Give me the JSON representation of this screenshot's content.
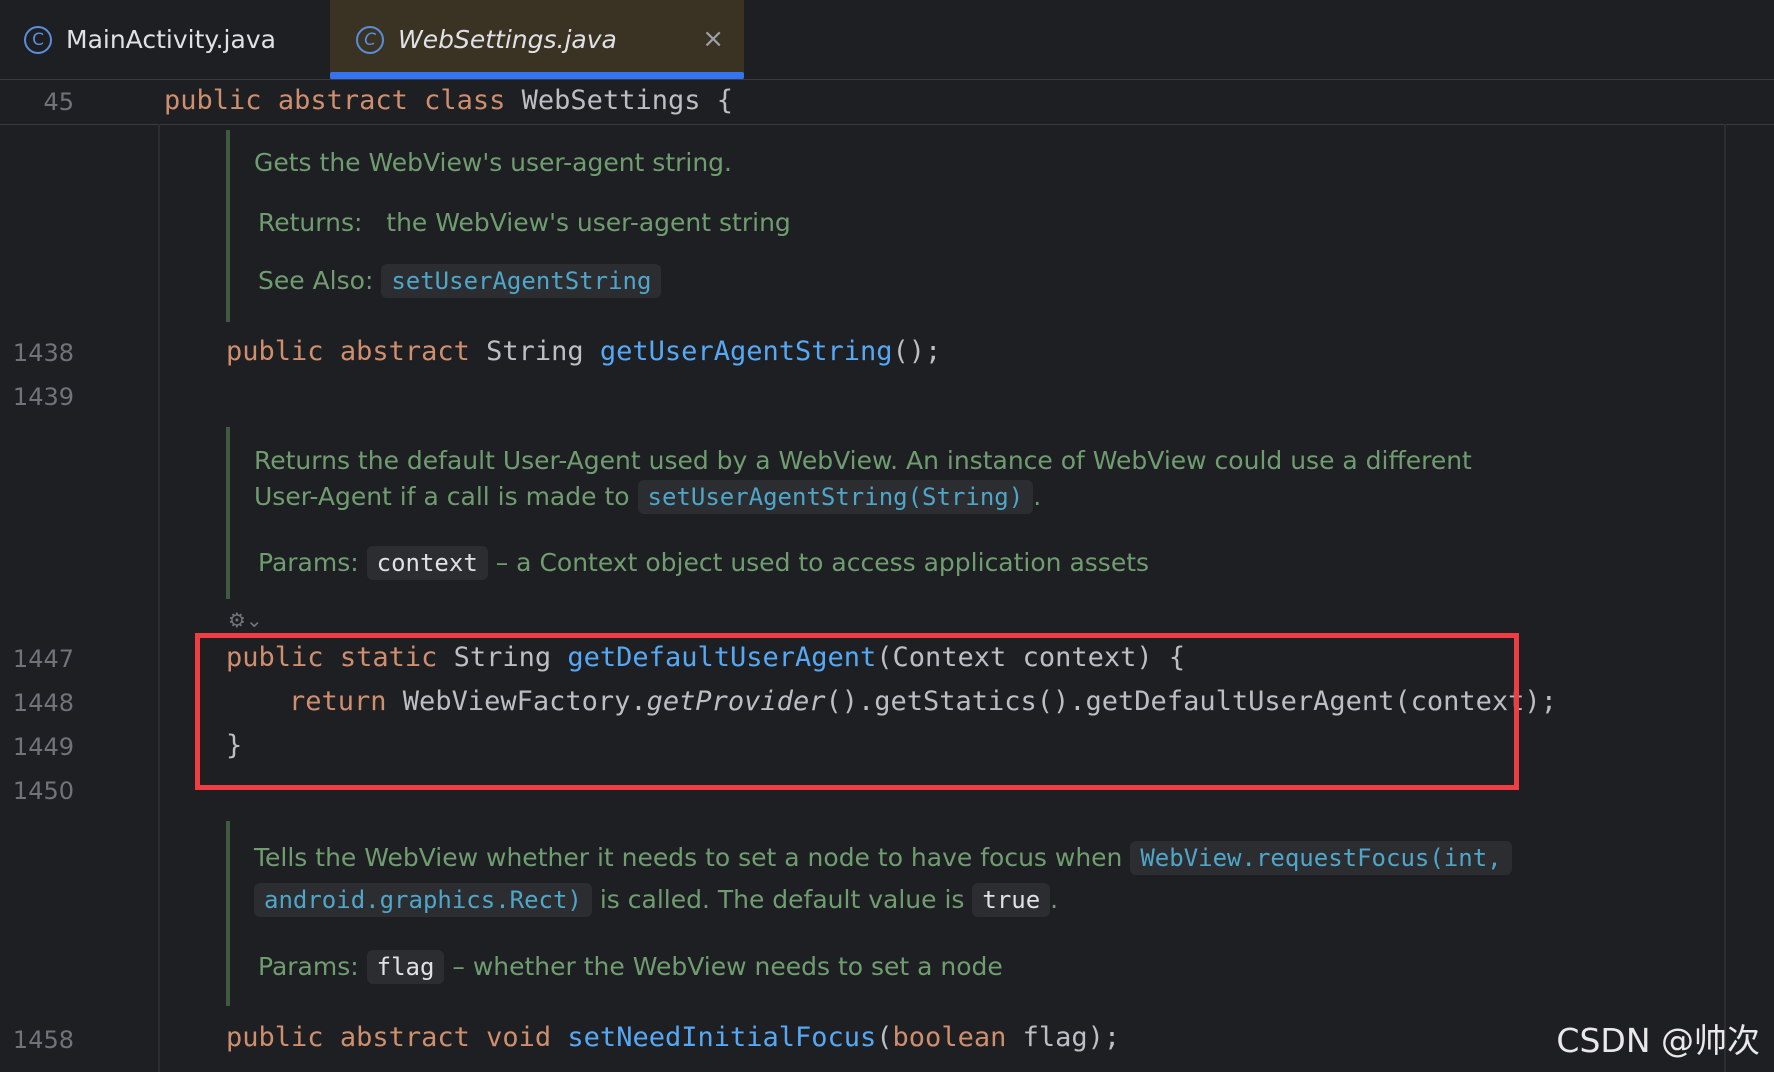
{
  "tabs": [
    {
      "label": "MainActivity.java",
      "icon": "class-c-icon",
      "active": false
    },
    {
      "label": "WebSettings.java",
      "icon": "class-c-icon",
      "active": true,
      "close_glyph": "×"
    }
  ],
  "sticky": {
    "line": "45",
    "kw1": "public",
    "kw2": "abstract",
    "kw3": "class",
    "rest": " WebSettings {"
  },
  "doc1": {
    "summary": "Gets the WebView's user-agent string.",
    "returns_label": "Returns:",
    "returns_text": "the WebView's user-agent string",
    "see_label": "See Also:",
    "see_link": "setUserAgentString"
  },
  "line1438": {
    "num": "1438",
    "kw1": "public",
    "kw2": "abstract",
    "type": " String ",
    "fn": "getUserAgentString",
    "rest": "();"
  },
  "line1439": {
    "num": "1439"
  },
  "doc2": {
    "line1": "Returns the default User-Agent used by a WebView. An instance of WebView could use a different",
    "line2_pre": "User-Agent if a call is made to",
    "line2_link": "setUserAgentString(String)",
    "line2_post": ".",
    "params_label": "Params:",
    "param_name": "context",
    "param_desc": "– a Context object used to access application assets"
  },
  "line1447": {
    "num": "1447",
    "kw1": "public",
    "kw2": "static",
    "type": " String ",
    "fn": "getDefaultUserAgent",
    "rest": "(Context context) {"
  },
  "line1448": {
    "num": "1448",
    "kw": "return",
    "a": " WebViewFactory.",
    "italic": "getProvider",
    "b": "().getStatics().getDefaultUserAgent(context);"
  },
  "line1449": {
    "num": "1449",
    "text": "}"
  },
  "line1450": {
    "num": "1450"
  },
  "doc3": {
    "line1_pre": "Tells the WebView whether it needs to set a node to have focus when",
    "link1": "WebView.requestFocus(int,",
    "link2": "android.graphics.Rect)",
    "mid": "is called. The default value is",
    "value": "true",
    "end": ".",
    "params_label": "Params:",
    "param_name": "flag",
    "param_desc": "– whether the WebView needs to set a node"
  },
  "line1458": {
    "num": "1458",
    "kw1": "public",
    "kw2": "abstract",
    "kw3": "void",
    "fn": "setNeedInitialFocus",
    "p1": "(",
    "kw4": "boolean",
    "rest": " flag);"
  },
  "watermark": "CSDN @帅次",
  "colors": {
    "keyword": "#cf8e6d",
    "function": "#56a8f5",
    "doc": "#6f9d70",
    "highlight": "#ee3d43",
    "tab_underline": "#3574f0"
  }
}
